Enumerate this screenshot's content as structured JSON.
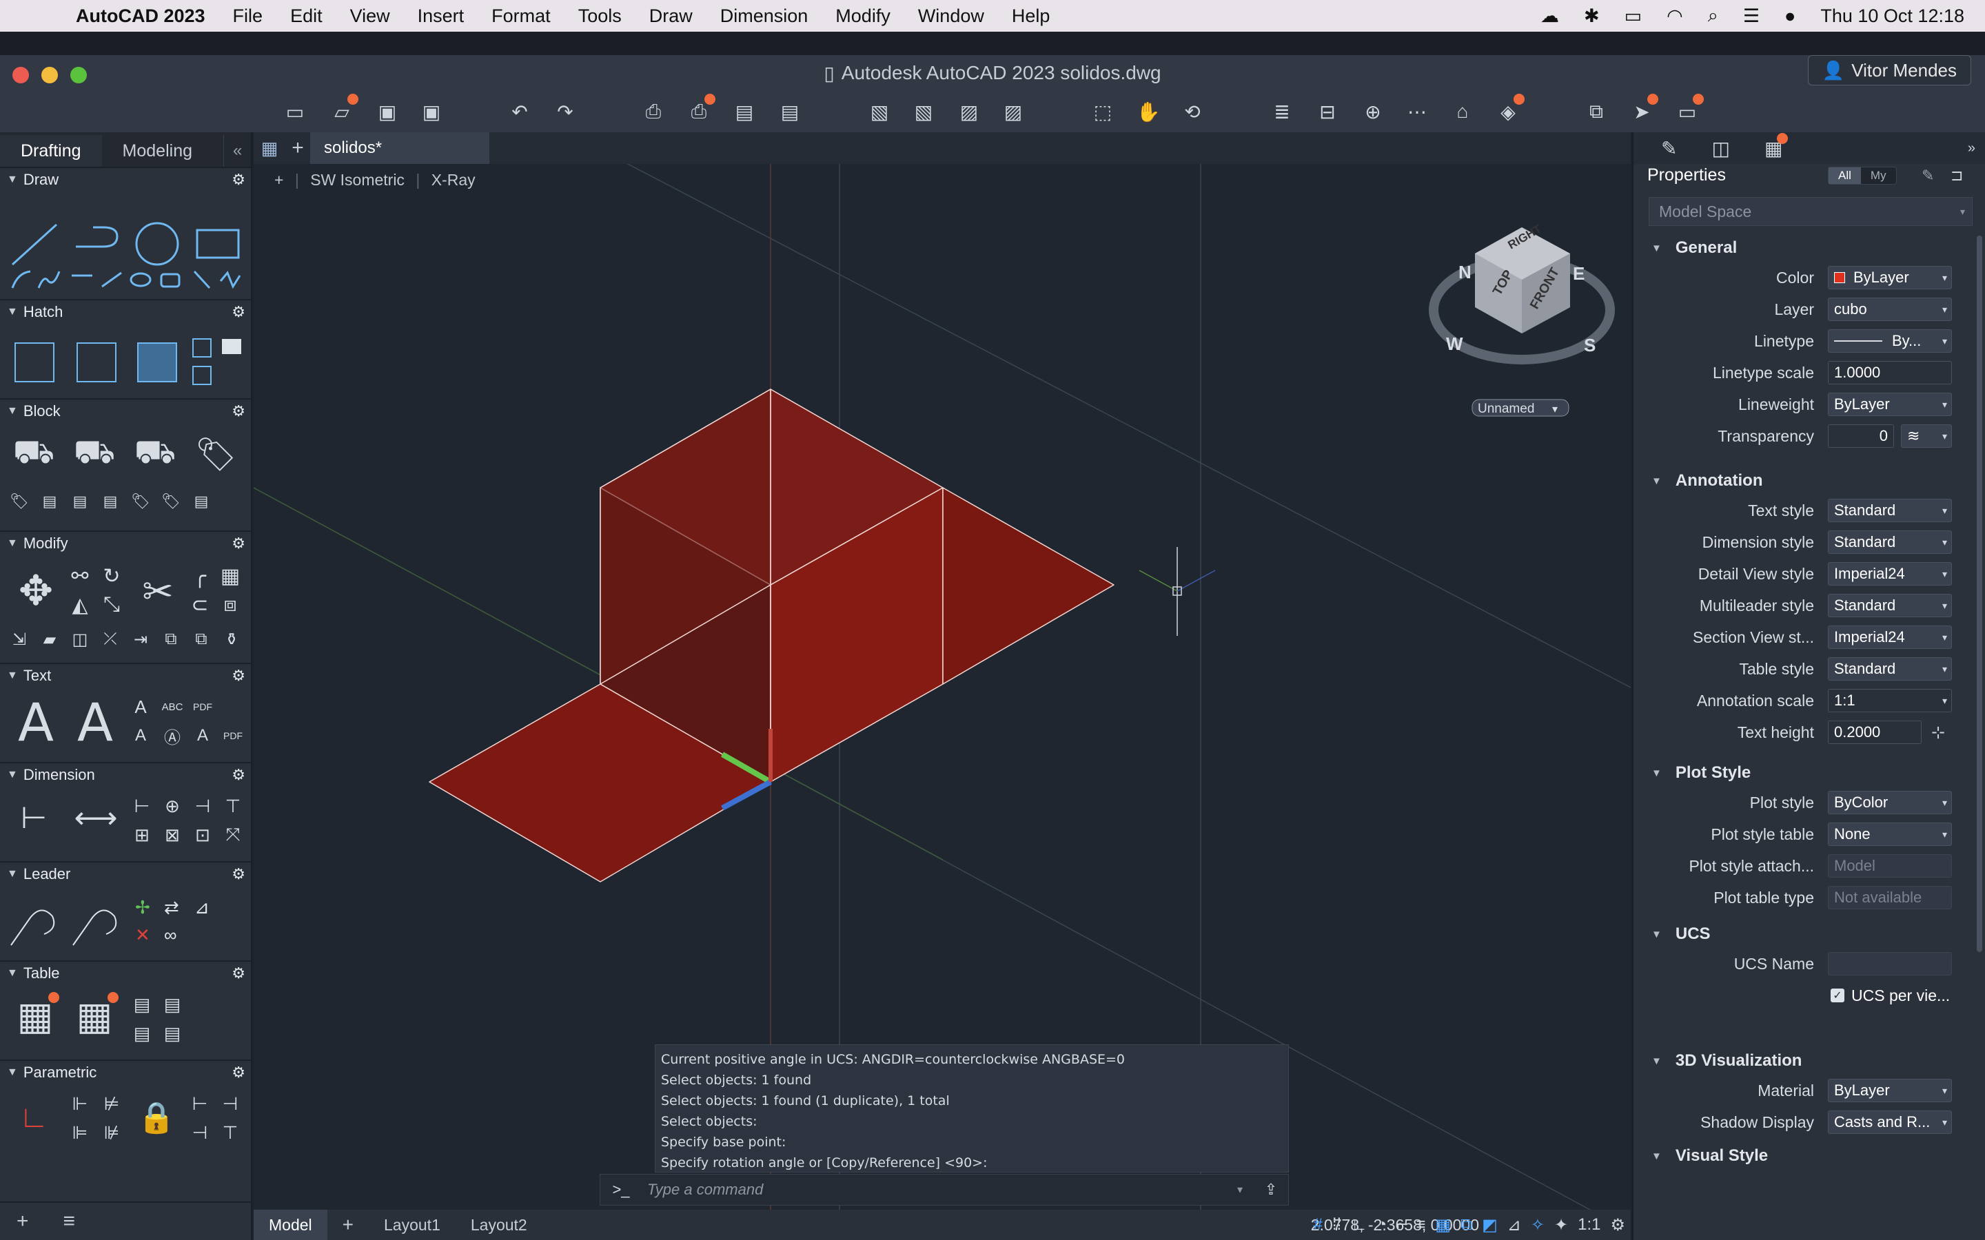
{
  "menubar": {
    "app": "AutoCAD 2023",
    "items": [
      "File",
      "Edit",
      "View",
      "Insert",
      "Format",
      "Tools",
      "Draw",
      "Dimension",
      "Modify",
      "Window",
      "Help"
    ],
    "datetime": "Thu 10 Oct  12:18"
  },
  "window": {
    "title": "Autodesk AutoCAD 2023    solidos.dwg",
    "user": "Vitor Mendes"
  },
  "left": {
    "tabs": [
      "Drafting",
      "Modeling"
    ],
    "sections": [
      "Draw",
      "Hatch",
      "Block",
      "Modify",
      "Text",
      "Dimension",
      "Leader",
      "Table",
      "Parametric"
    ]
  },
  "doc": {
    "tab": "solidos*",
    "view_label": "SW Isometric",
    "visual_label": "X-Ray",
    "viewcube": {
      "faces": [
        "TOP",
        "FRONT",
        "RIGHT"
      ],
      "compass": [
        "N",
        "W",
        "S",
        "E"
      ],
      "ucs": "Unnamed"
    }
  },
  "command": {
    "history": [
      "Current positive angle in UCS:  ANGDIR=counterclockwise  ANGBASE=0",
      "Select objects: 1 found",
      "Select objects: 1 found (1 duplicate), 1 total",
      "Select objects:",
      "Specify base point:",
      "Specify rotation angle or [Copy/Reference] <90>:"
    ],
    "prompt": ">_",
    "placeholder": "Type a command"
  },
  "bottom": {
    "tabs": [
      "Model",
      "Layout1",
      "Layout2"
    ],
    "coords": "2.0778,  -2.3658, 0.0000",
    "scale": "1:1"
  },
  "properties": {
    "title": "Properties",
    "filters": [
      "All",
      "My"
    ],
    "selector": "Model Space",
    "groups": [
      {
        "name": "General",
        "rows": [
          {
            "label": "Color",
            "value": "ByLayer",
            "color": "#e0301e"
          },
          {
            "label": "Layer",
            "value": "cubo"
          },
          {
            "label": "Linetype",
            "value": "By..."
          },
          {
            "label": "Linetype scale",
            "value": "1.0000",
            "edit": true
          },
          {
            "label": "Lineweight",
            "value": "ByLayer"
          },
          {
            "label": "Transparency",
            "value": "0",
            "edit": true
          }
        ]
      },
      {
        "name": "Annotation",
        "rows": [
          {
            "label": "Text style",
            "value": "Standard"
          },
          {
            "label": "Dimension style",
            "value": "Standard"
          },
          {
            "label": "Detail View style",
            "value": "Imperial24"
          },
          {
            "label": "Multileader style",
            "value": "Standard"
          },
          {
            "label": "Section View st...",
            "value": "Imperial24"
          },
          {
            "label": "Table style",
            "value": "Standard"
          },
          {
            "label": "Annotation scale",
            "value": "1:1"
          },
          {
            "label": "Text height",
            "value": "0.2000",
            "edit": true
          }
        ]
      },
      {
        "name": "Plot Style",
        "rows": [
          {
            "label": "Plot style",
            "value": "ByColor"
          },
          {
            "label": "Plot style table",
            "value": "None"
          },
          {
            "label": "Plot style attach...",
            "value": "Model",
            "disabled": true
          },
          {
            "label": "Plot table type",
            "value": "Not available",
            "disabled": true
          }
        ]
      },
      {
        "name": "UCS",
        "rows": [
          {
            "label": "UCS Name",
            "value": "",
            "disabled": true
          },
          {
            "label": "",
            "value": "UCS per vie...",
            "checkbox": true
          }
        ]
      },
      {
        "name": "3D Visualization",
        "rows": [
          {
            "label": "Material",
            "value": "ByLayer"
          },
          {
            "label": "Shadow Display",
            "value": "Casts and R..."
          }
        ]
      },
      {
        "name": "Visual Style",
        "rows": []
      }
    ]
  }
}
